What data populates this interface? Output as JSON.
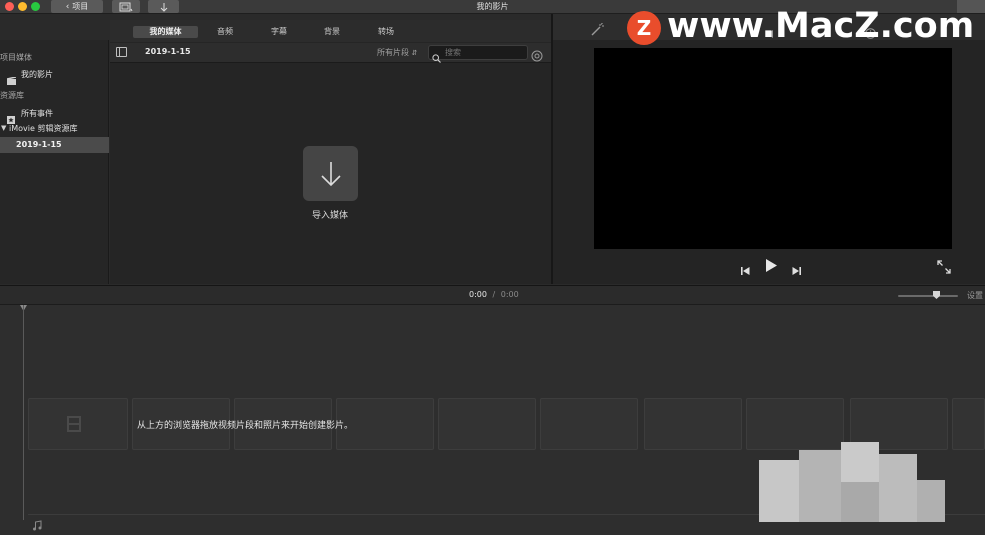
{
  "window": {
    "title": "我的影片",
    "back_label": "项目"
  },
  "tabs": [
    {
      "label": "我的媒体",
      "active": true
    },
    {
      "label": "音频"
    },
    {
      "label": "字幕"
    },
    {
      "label": "背景"
    },
    {
      "label": "转场"
    }
  ],
  "sidebar": {
    "project_media_header": "项目媒体",
    "project_item": "我的影片",
    "library_header": "资源库",
    "all_events": "所有事件",
    "library_name": "iMovie 剪辑资源库",
    "selected_event": "2019-1-15"
  },
  "browser": {
    "event_title": "2019-1-15",
    "filter_label": "所有片段",
    "search_placeholder": "搜索",
    "import_label": "导入媒体"
  },
  "timeline": {
    "current_time": "0:00",
    "separator": "/",
    "total_time": "0:00",
    "settings_label": "设置",
    "hint": "从上方的浏览器拖放视频片段和照片来开始创建影片。"
  },
  "watermark": {
    "logo_letter": "Z",
    "text": "www.MacZ.com"
  },
  "colors": {
    "watermark_accent": "#e94d2c",
    "close": "#fd5f57",
    "minimize": "#febb2e",
    "zoom": "#28c840"
  }
}
